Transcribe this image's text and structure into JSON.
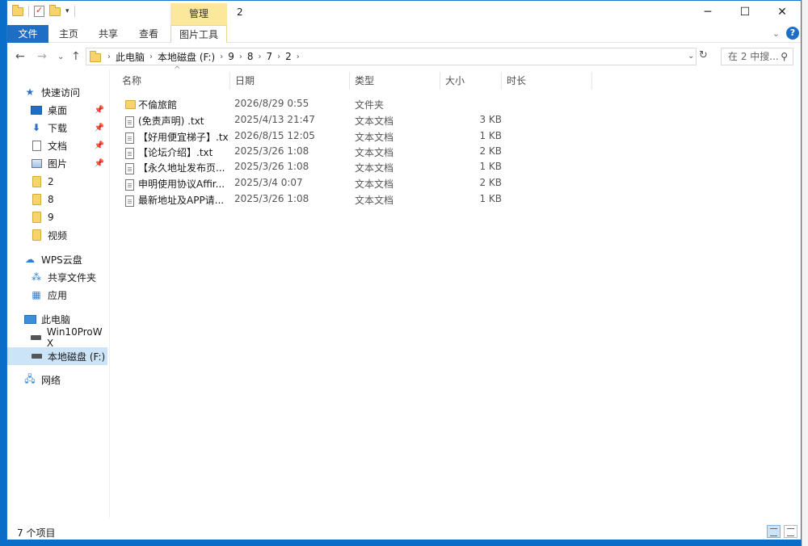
{
  "titlebar": {
    "manage_tab": "管理",
    "title": "2",
    "minimize": "─",
    "maximize": "☐",
    "close": "✕"
  },
  "ribbon": {
    "tabs": [
      "文件",
      "主页",
      "共享",
      "查看",
      "图片工具"
    ],
    "help": "?"
  },
  "address": {
    "crumbs": [
      "此电脑",
      "本地磁盘 (F:)",
      "9",
      "8",
      "7",
      "2"
    ],
    "search_placeholder": "在 2 中搜..."
  },
  "nav": {
    "quick_access": "快速访问",
    "items": [
      {
        "label": "桌面",
        "icon": "desktop-icon"
      },
      {
        "label": "下载",
        "icon": "download-icon"
      },
      {
        "label": "文档",
        "icon": "document-icon"
      },
      {
        "label": "图片",
        "icon": "picture-icon"
      },
      {
        "label": "2",
        "icon": "folder-icon"
      },
      {
        "label": "8",
        "icon": "folder-icon"
      },
      {
        "label": "9",
        "icon": "folder-icon"
      },
      {
        "label": "视频",
        "icon": "folder-icon"
      }
    ],
    "wps_cloud": "WPS云盘",
    "shared_folder": "共享文件夹",
    "apps": "应用",
    "this_pc": "此电脑",
    "drive1": "Win10ProW X",
    "drive2": "本地磁盘 (F:)",
    "network": "网络"
  },
  "columns": {
    "name": "名称",
    "date": "日期",
    "type": "类型",
    "size": "大小",
    "duration": "时长"
  },
  "files": [
    {
      "name": "不倫旅館",
      "date": "2026/8/29 0:55",
      "type": "文件夹",
      "size": "",
      "icon": "folder-icon"
    },
    {
      "name": "(免责声明) .txt",
      "date": "2025/4/13 21:47",
      "type": "文本文档",
      "size": "3 KB",
      "icon": "text-file-icon"
    },
    {
      "name": "【好用便宜梯子】.txt",
      "date": "2026/8/15 12:05",
      "type": "文本文档",
      "size": "1 KB",
      "icon": "text-file-icon"
    },
    {
      "name": "【论坛介绍】.txt",
      "date": "2025/3/26 1:08",
      "type": "文本文档",
      "size": "2 KB",
      "icon": "text-file-icon"
    },
    {
      "name": "【永久地址发布页...",
      "date": "2025/3/26 1:08",
      "type": "文本文档",
      "size": "1 KB",
      "icon": "text-file-icon"
    },
    {
      "name": "申明使用协议Affir...",
      "date": "2025/3/4 0:07",
      "type": "文本文档",
      "size": "2 KB",
      "icon": "text-file-icon"
    },
    {
      "name": "最新地址及APP请...",
      "date": "2025/3/26 1:08",
      "type": "文本文档",
      "size": "1 KB",
      "icon": "text-file-icon"
    }
  ],
  "status": {
    "count": "7 个项目"
  }
}
